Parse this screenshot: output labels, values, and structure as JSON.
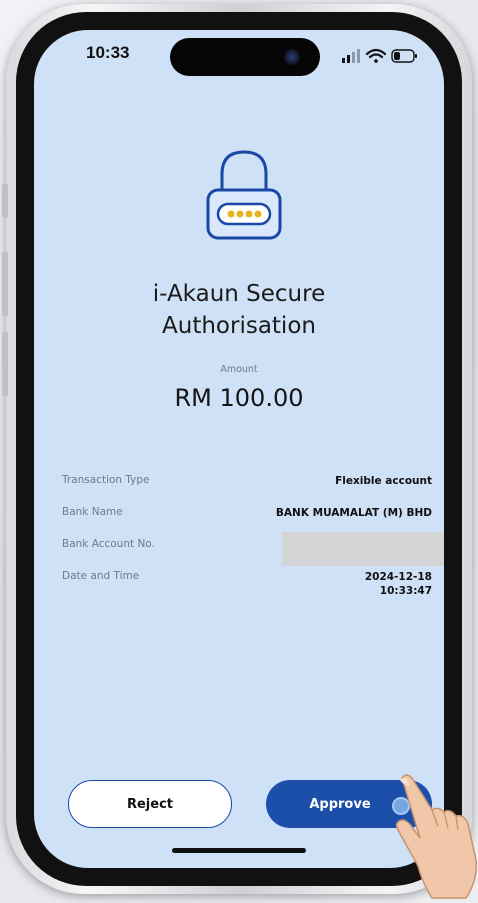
{
  "status_bar": {
    "time": "10:33"
  },
  "header": {
    "title_line1": "i-Akaun Secure",
    "title_line2": "Authorisation"
  },
  "amount": {
    "label": "Amount",
    "value": "RM 100.00"
  },
  "details": [
    {
      "label": "Transaction Type",
      "value": "Flexible account"
    },
    {
      "label": "Bank Name",
      "value": "BANK MUAMALAT (M) BHD"
    },
    {
      "label": "Bank Account No.",
      "value": ""
    },
    {
      "label": "Date and Time",
      "value_line1": "2024-12-18",
      "value_line2": "10:33:47"
    }
  ],
  "actions": {
    "reject_label": "Reject",
    "approve_label": "Approve"
  },
  "colors": {
    "screen_bg": "#cfe1f6",
    "accent": "#1c4faa",
    "lock_stroke": "#1b47a6",
    "lock_dots": "#e6b420"
  },
  "icons": {
    "lock": "padlock-with-pin-dots-icon",
    "signal": "cellular-signal-icon",
    "wifi": "wifi-icon",
    "battery": "battery-icon"
  }
}
